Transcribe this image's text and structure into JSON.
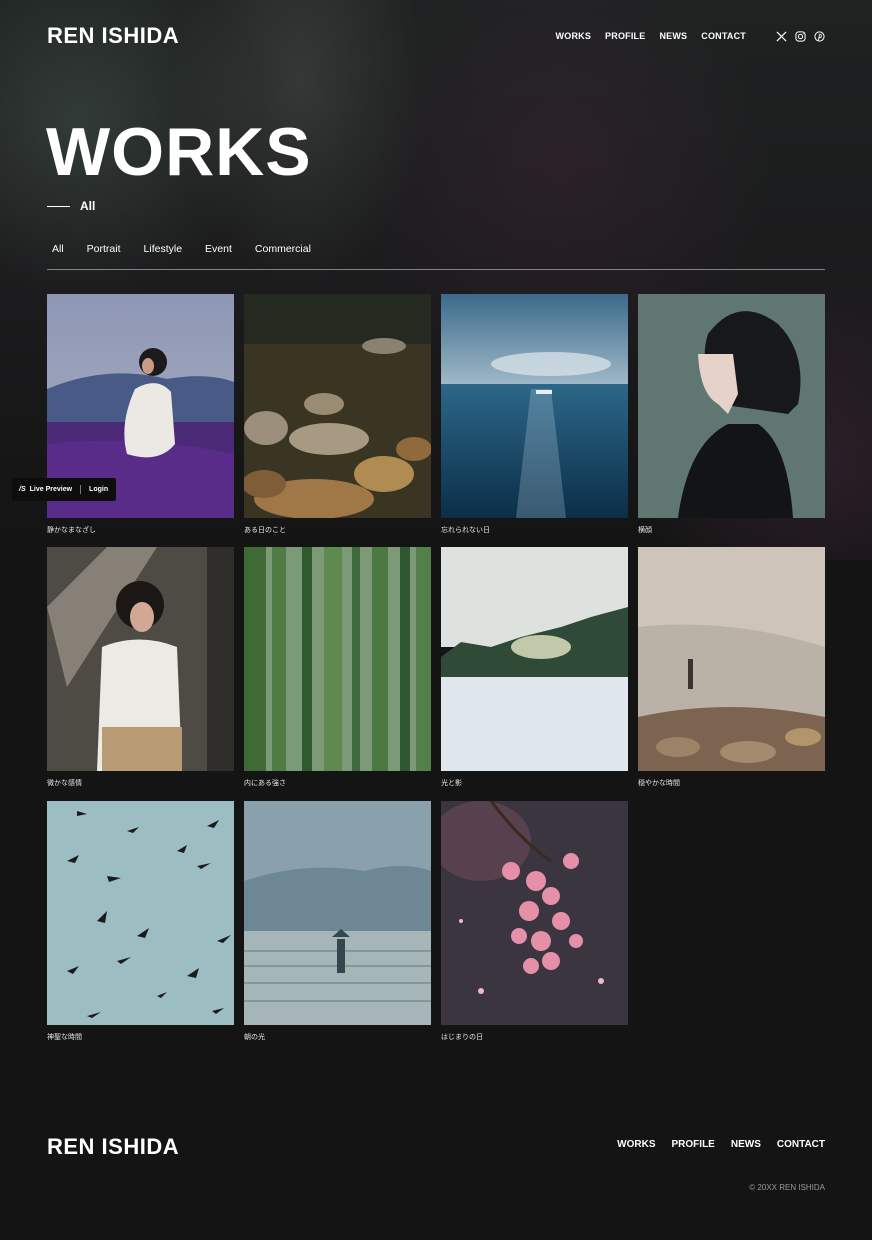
{
  "header": {
    "logo": "REN ISHIDA",
    "nav": [
      "WORKS",
      "PROFILE",
      "NEWS",
      "CONTACT"
    ],
    "social_icons": [
      "x-icon",
      "instagram-icon",
      "pinterest-icon"
    ]
  },
  "page": {
    "title": "WORKS",
    "subtitle": "All"
  },
  "filters": [
    "All",
    "Portrait",
    "Lifestyle",
    "Event",
    "Commercial"
  ],
  "works": [
    {
      "caption": "静かなまなざし"
    },
    {
      "caption": "ある日のこと"
    },
    {
      "caption": "忘れられない日"
    },
    {
      "caption": "横顔"
    },
    {
      "caption": "微かな感情"
    },
    {
      "caption": "内にある強さ"
    },
    {
      "caption": "光と影"
    },
    {
      "caption": "穏やかな時間"
    },
    {
      "caption": "神聖な時間"
    },
    {
      "caption": "朝の光"
    },
    {
      "caption": "はじまりの日"
    }
  ],
  "preview_badge": {
    "live_preview": "Live Preview",
    "login": "Login"
  },
  "footer": {
    "logo": "REN ISHIDA",
    "nav": [
      "WORKS",
      "PROFILE",
      "NEWS",
      "CONTACT"
    ],
    "copyright": "© 20XX REN ISHIDA"
  }
}
